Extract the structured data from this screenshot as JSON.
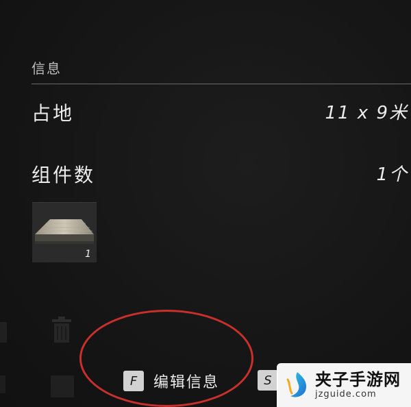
{
  "info_panel": {
    "section_title": "信息",
    "rows": [
      {
        "label": "占地",
        "value": "11 x 9米"
      },
      {
        "label": "组件数",
        "value": "1个"
      }
    ],
    "item_slot": {
      "icon": "wooden-floor-plank-icon",
      "count": "1"
    }
  },
  "footer": {
    "edit_hint": {
      "key": "F",
      "label": "编辑信息"
    },
    "next_hint": {
      "key": "S"
    }
  },
  "background_icons": [
    "trash-can-icon"
  ],
  "annotation": {
    "color": "#c9302c"
  },
  "watermark": {
    "title": "夹子手游网",
    "url": "jzguide.com"
  }
}
